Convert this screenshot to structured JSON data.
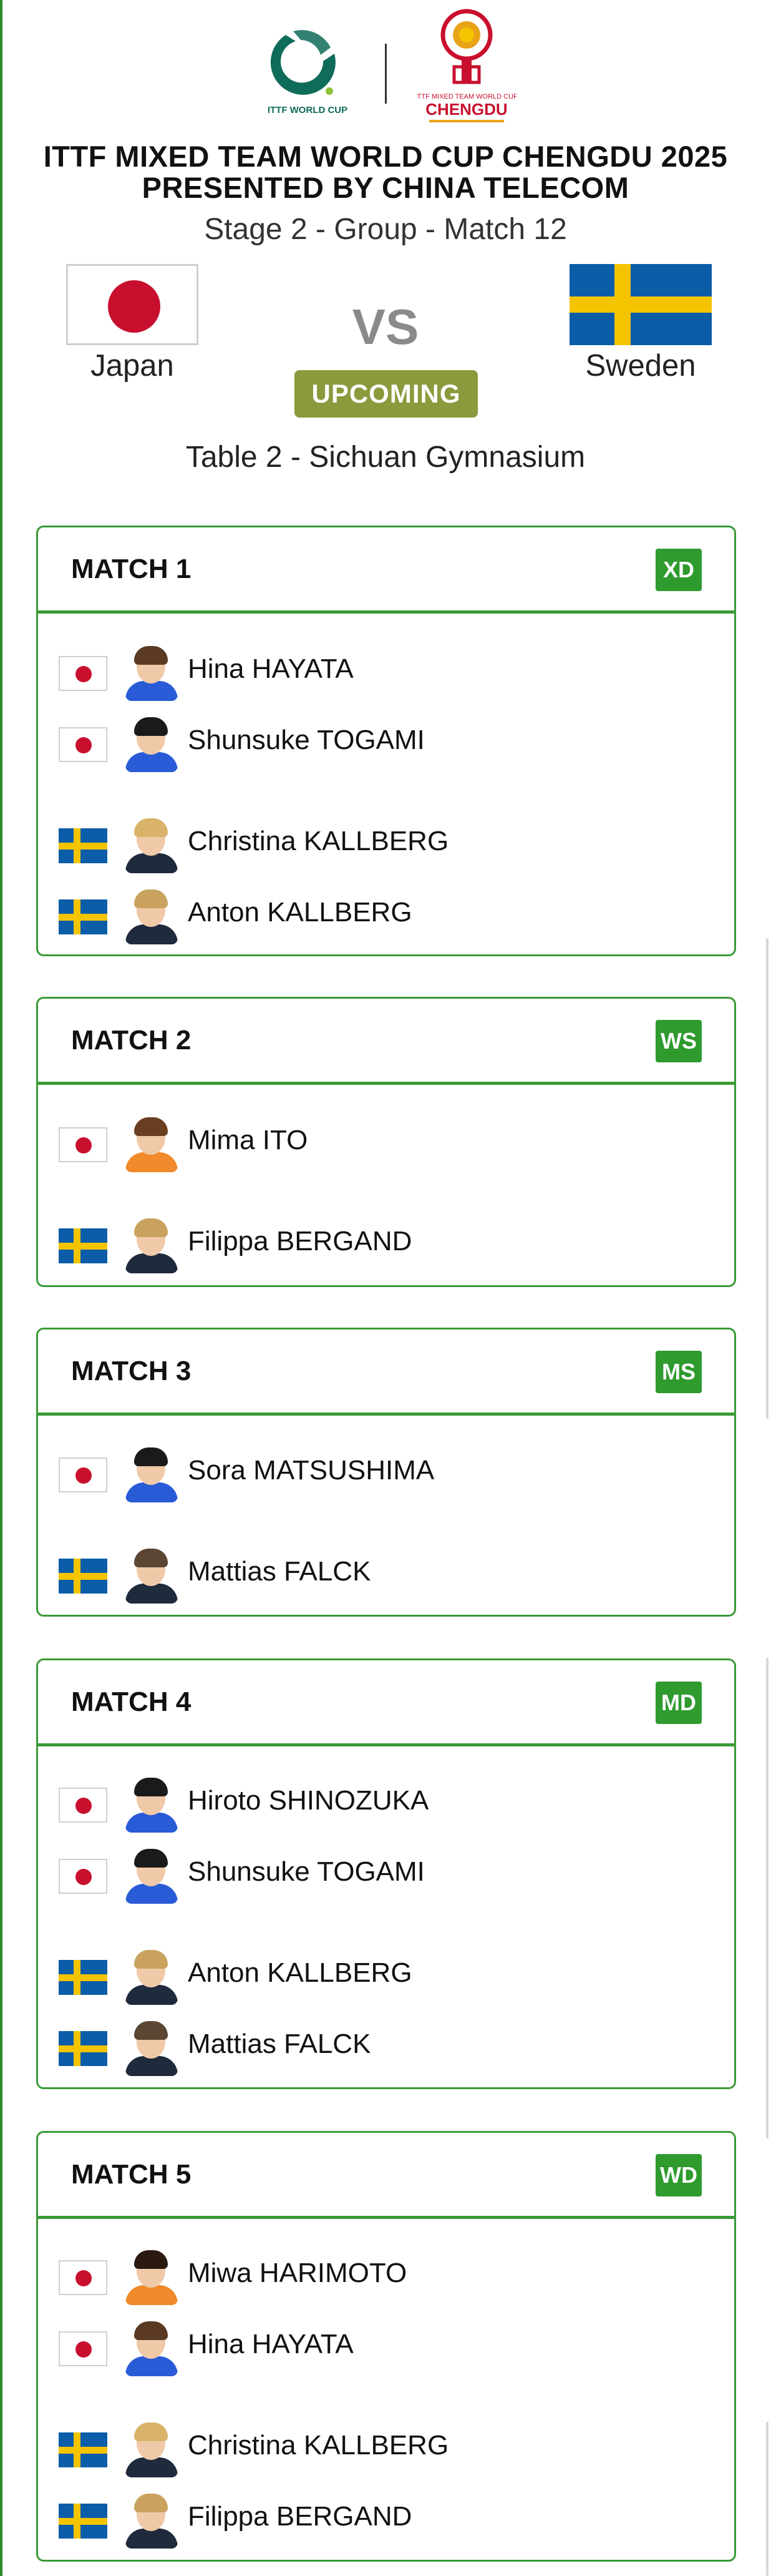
{
  "header": {
    "ittf_logo_text": "ITTF WORLD CUP",
    "event_logo_text_1": "ITTF MIXED TEAM WORLD CUP",
    "event_logo_text_2": "CHENGDU",
    "title_line1": "ITTF MIXED TEAM WORLD CUP CHENGDU 2025",
    "title_line2": "PRESENTED BY CHINA TELECOM",
    "subtitle": "Stage 2 - Group - Match 12"
  },
  "teams": {
    "home": {
      "name": "Japan",
      "flag": "japan-flag"
    },
    "away": {
      "name": "Sweden",
      "flag": "sweden-flag"
    },
    "vs_label": "VS",
    "status": "UPCOMING"
  },
  "venue": "Table 2 - Sichuan Gymnasium",
  "colors": {
    "accent": "#3a9a36",
    "badge": "#2f9a2e",
    "status": "#8a9a3c",
    "jp_red": "#c8102e",
    "se_blue": "#0b5da8",
    "se_yellow": "#f5c400"
  },
  "matches": [
    {
      "title": "MATCH 1",
      "badge": "XD",
      "players": [
        {
          "name": "Hina HAYATA",
          "country": "Japan"
        },
        {
          "name": "Shunsuke TOGAMI",
          "country": "Japan"
        },
        {
          "name": "Christina KALLBERG",
          "country": "Sweden"
        },
        {
          "name": "Anton KALLBERG",
          "country": "Sweden"
        }
      ]
    },
    {
      "title": "MATCH 2",
      "badge": "WS",
      "players": [
        {
          "name": "Mima ITO",
          "country": "Japan"
        },
        {
          "name": "Filippa BERGAND",
          "country": "Sweden"
        }
      ]
    },
    {
      "title": "MATCH 3",
      "badge": "MS",
      "players": [
        {
          "name": "Sora MATSUSHIMA",
          "country": "Japan"
        },
        {
          "name": "Mattias FALCK",
          "country": "Sweden"
        }
      ]
    },
    {
      "title": "MATCH 4",
      "badge": "MD",
      "players": [
        {
          "name": "Hiroto SHINOZUKA",
          "country": "Japan"
        },
        {
          "name": "Shunsuke TOGAMI",
          "country": "Japan"
        },
        {
          "name": "Anton KALLBERG",
          "country": "Sweden"
        },
        {
          "name": "Mattias FALCK",
          "country": "Sweden"
        }
      ]
    },
    {
      "title": "MATCH 5",
      "badge": "WD",
      "players": [
        {
          "name": "Miwa HARIMOTO",
          "country": "Japan"
        },
        {
          "name": "Hina HAYATA",
          "country": "Japan"
        },
        {
          "name": "Christina KALLBERG",
          "country": "Sweden"
        },
        {
          "name": "Filippa BERGAND",
          "country": "Sweden"
        }
      ]
    }
  ]
}
